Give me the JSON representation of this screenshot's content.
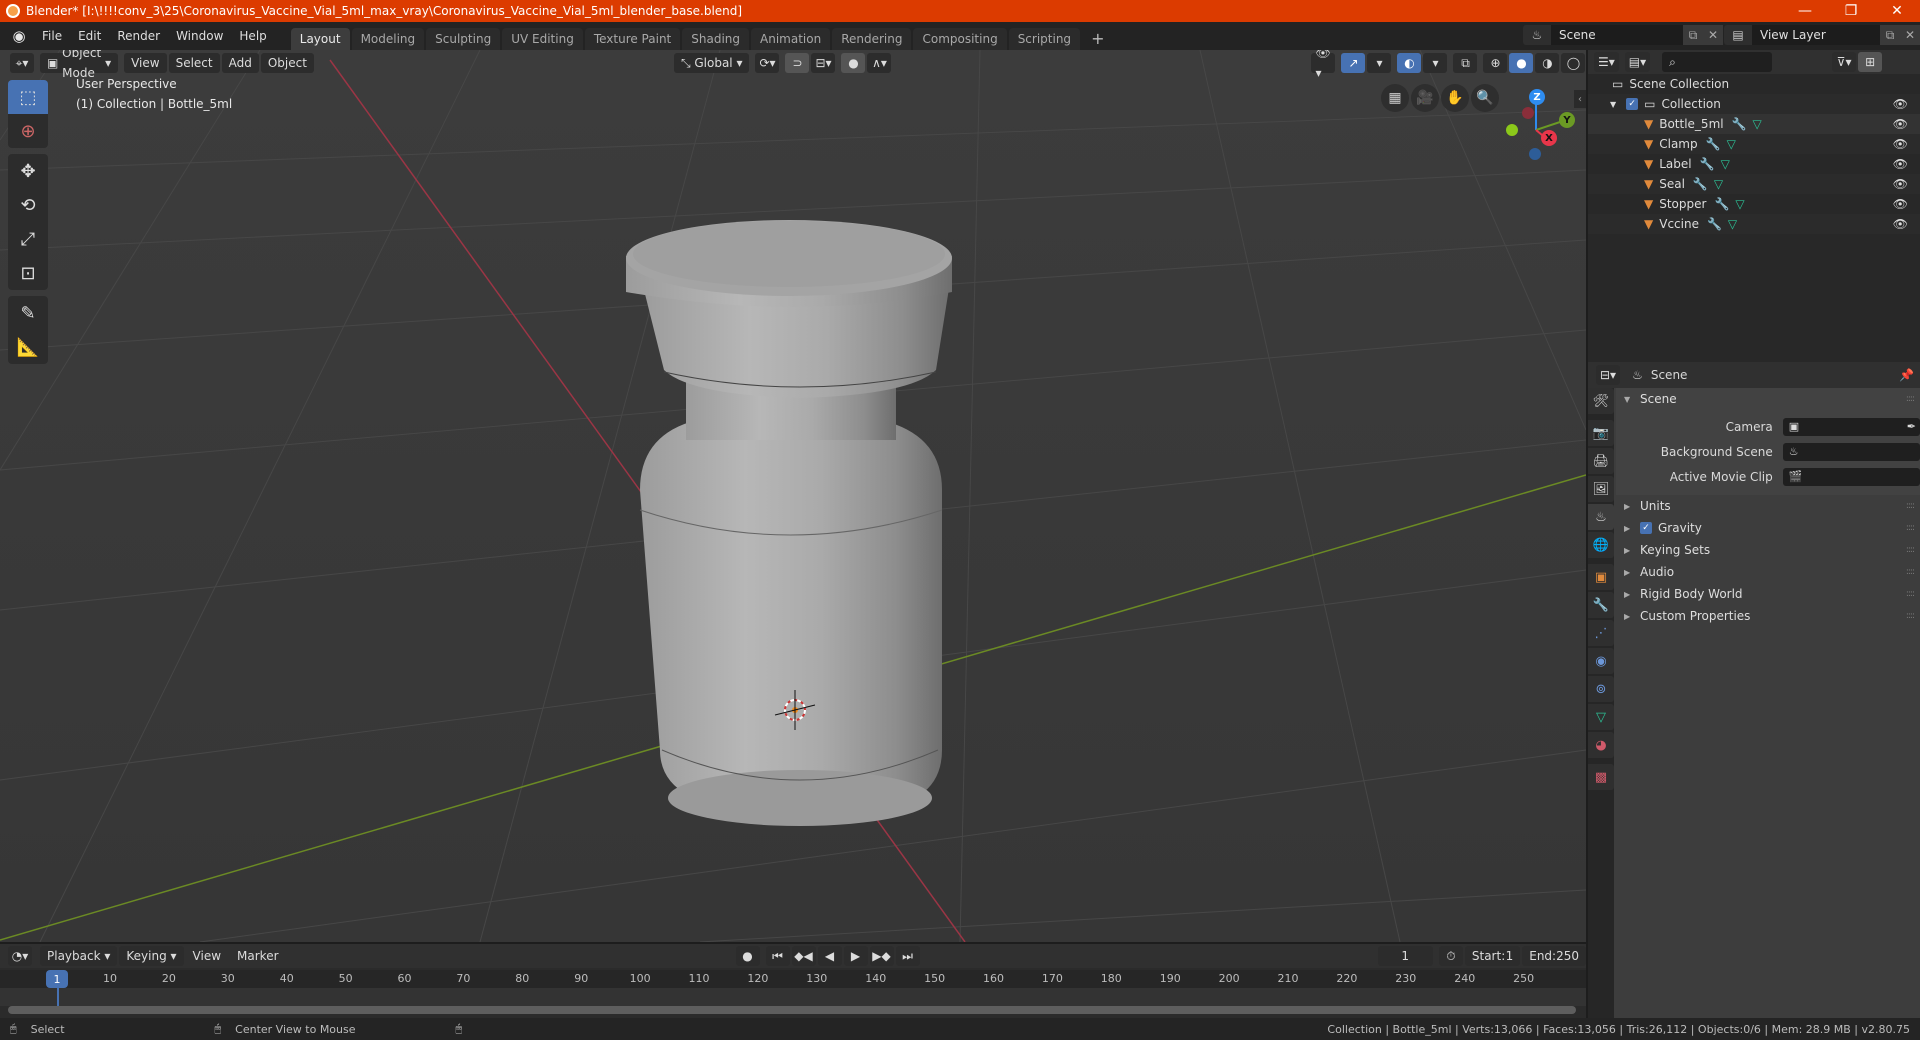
{
  "window": {
    "title": "Blender* [I:\\!!!!conv_3\\25\\Coronavirus_Vaccine_Vial_5ml_max_vray\\Coronavirus_Vaccine_Vial_5ml_blender_base.blend]",
    "controls": {
      "minimize": "—",
      "maximize": "❐",
      "close": "✕"
    },
    "accent_color": "#dc3b00"
  },
  "menu": {
    "items": [
      "File",
      "Edit",
      "Render",
      "Window",
      "Help"
    ],
    "workspaces": [
      "Layout",
      "Modeling",
      "Sculpting",
      "UV Editing",
      "Texture Paint",
      "Shading",
      "Animation",
      "Rendering",
      "Compositing",
      "Scripting"
    ],
    "active_workspace": "Layout",
    "add_workspace": "+",
    "scene": "Scene",
    "view_layer": "View Layer"
  },
  "viewport": {
    "mode": "Object Mode",
    "menus": [
      "View",
      "Select",
      "Add",
      "Object"
    ],
    "transform_orientation": "Global",
    "perspective_label": "User Perspective",
    "active_label": "(1) Collection | Bottle_5ml",
    "gizmo": {
      "x": "X",
      "y": "Y",
      "z": "Z"
    },
    "tools": [
      "select-box",
      "cursor",
      "move",
      "rotate",
      "scale",
      "transform",
      "annotate",
      "measure"
    ]
  },
  "outliner": {
    "root": "Scene Collection",
    "collection": "Collection",
    "objects": [
      {
        "name": "Bottle_5ml",
        "selected": true
      },
      {
        "name": "Clamp",
        "selected": false
      },
      {
        "name": "Label",
        "selected": false
      },
      {
        "name": "Seal",
        "selected": false
      },
      {
        "name": "Stopper",
        "selected": false
      },
      {
        "name": "Vccine",
        "selected": false
      }
    ]
  },
  "properties": {
    "context": "Scene",
    "panel_title": "Scene",
    "fields": [
      {
        "label": "Camera",
        "value": ""
      },
      {
        "label": "Background Scene",
        "value": ""
      },
      {
        "label": "Active Movie Clip",
        "value": ""
      }
    ],
    "subpanels": [
      "Units",
      "Gravity",
      "Keying Sets",
      "Audio",
      "Rigid Body World",
      "Custom Properties"
    ],
    "gravity_enabled": true
  },
  "timeline": {
    "menus": [
      "Playback",
      "Keying",
      "View",
      "Marker"
    ],
    "current_frame": "1",
    "start_label": "Start:",
    "start": "1",
    "end_label": "End:",
    "end": "250",
    "ticks": [
      "10",
      "20",
      "30",
      "40",
      "50",
      "60",
      "70",
      "80",
      "90",
      "100",
      "110",
      "120",
      "130",
      "140",
      "150",
      "160",
      "170",
      "180",
      "190",
      "200",
      "210",
      "220",
      "230",
      "240",
      "250"
    ]
  },
  "statusbar": {
    "left_hint": "Select",
    "middle_hint": "Center View to Mouse",
    "stats": "Collection | Bottle_5ml | Verts:13,066 | Faces:13,056 | Tris:26,112 | Objects:0/6 | Mem: 28.9 MB | v2.80.75"
  }
}
